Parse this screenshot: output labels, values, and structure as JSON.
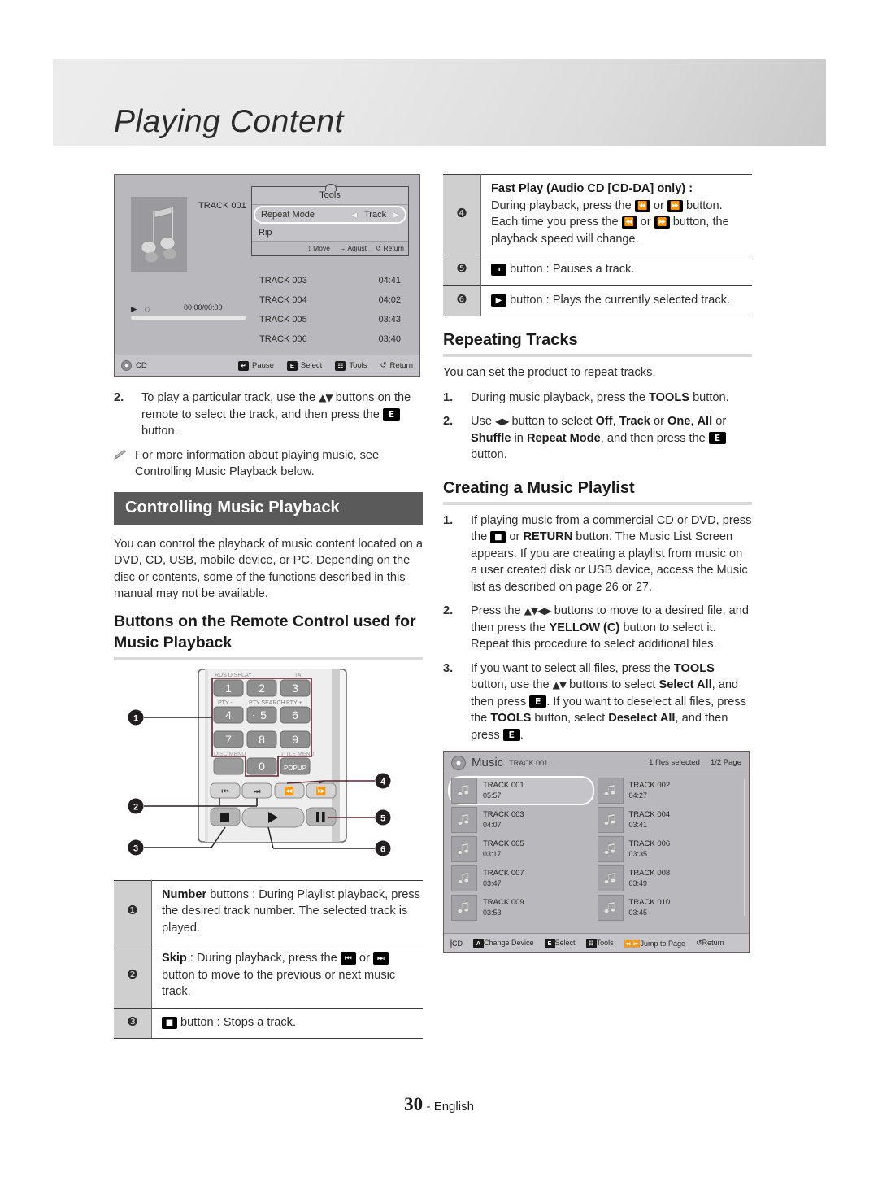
{
  "header": {
    "title": "Playing Content"
  },
  "cd_screen": {
    "now_playing_track": "TRACK 001",
    "time": "00:00/00:00",
    "tools": {
      "title": "Tools",
      "rows": [
        {
          "label": "Repeat Mode",
          "value": "Track"
        },
        {
          "label": "Rip",
          "value": ""
        }
      ],
      "footer": [
        "Move",
        "Adjust",
        "Return"
      ]
    },
    "tracks": [
      {
        "name": "TRACK 003",
        "time": "04:41"
      },
      {
        "name": "TRACK 004",
        "time": "04:02"
      },
      {
        "name": "TRACK 005",
        "time": "03:43"
      },
      {
        "name": "TRACK 006",
        "time": "03:40"
      }
    ],
    "footer": {
      "source": "CD",
      "actions": [
        "Pause",
        "Select",
        "Tools",
        "Return"
      ]
    }
  },
  "left": {
    "step2": {
      "num": "2.",
      "text_a": "To play a particular track, use the ",
      "glyph_a": "▲▼",
      "text_b": " buttons on the remote to select the track, and then press the ",
      "text_c": " button."
    },
    "note": "For more information about playing music, see Controlling Music Playback below.",
    "section_title": "Controlling Music Playback",
    "intro": "You can control the playback of music content located on a DVD, CD, USB, mobile device, or PC. Depending on the disc or contents, some of the functions described in this manual may not be available.",
    "remote_heading": "Buttons on the Remote Control used for Music Playback",
    "remote": {
      "top_labels": [
        "RDS DISPLAY",
        "TA"
      ],
      "mid_labels": [
        "PTY -",
        "PTY SEARCH",
        "PTY +"
      ],
      "bot_labels": [
        "DISC MENU",
        "TITLE MENU"
      ],
      "keys": [
        "1",
        "2",
        "3",
        "4",
        "5",
        "6",
        "7",
        "8",
        "9",
        "0"
      ],
      "popup_label": "POPUP",
      "callouts": [
        "1",
        "2",
        "3",
        "4",
        "5",
        "6"
      ]
    },
    "table": [
      {
        "num": "❶",
        "bold": "Number",
        "text": " buttons : During Playlist playback, press the desired track number. The selected track is played."
      },
      {
        "num": "❷",
        "bold": "Skip",
        "text_a": " : During playback, press the ",
        "text_b": " or ",
        "text_c": " button to move to the previous or next music track."
      },
      {
        "num": "❸",
        "text": " button : Stops a track."
      }
    ]
  },
  "right": {
    "table": [
      {
        "num": "❹",
        "bold": "Fast Play (Audio CD [CD-DA] only) :",
        "line1_a": "During playback, press the ",
        "line1_b": " or ",
        "line1_c": " button.",
        "line2_a": "Each time you press the ",
        "line2_b": " or ",
        "line2_c": " button, the playback speed will change."
      },
      {
        "num": "❺",
        "text": " button : Pauses a track."
      },
      {
        "num": "❻",
        "text": " button : Plays the currently selected track."
      }
    ],
    "repeating": {
      "heading": "Repeating Tracks",
      "intro": "You can set the product to repeat tracks.",
      "steps": [
        {
          "num": "1.",
          "text_a": "During music playback, press the ",
          "bold": "TOOLS",
          "text_b": " button."
        },
        {
          "num": "2.",
          "text_a": "Use ",
          "glyph": "◀▶",
          "text_b": " button to select ",
          "opt1": "Off",
          "sep1": ", ",
          "opt2": "Track",
          "sep2": " or ",
          "opt3": "One",
          "sep3": ", ",
          "opt4": "All",
          "sep4": " or ",
          "opt5": "Shuffle",
          "text_c": " in ",
          "opt6": "Repeat Mode",
          "text_d": ", and then press the ",
          "text_e": " button."
        }
      ]
    },
    "playlist": {
      "heading": "Creating a Music Playlist",
      "steps": [
        {
          "num": "1.",
          "text_a": "If playing music from a commercial CD or DVD, press the ",
          "text_b": " or ",
          "bold1": "RETURN",
          "text_c": " button. The Music List Screen appears. If you are creating a playlist from music on a user created disk or USB device, access the Music list as described on page 26 or 27."
        },
        {
          "num": "2.",
          "text_a": "Press the ",
          "glyph": "▲▼◀▶",
          "text_b": " buttons to move to a desired file, and then press the ",
          "bold1": "YELLOW (C)",
          "text_c": " button to select it. Repeat this procedure to select additional files."
        },
        {
          "num": "3.",
          "text_a": "If you want to select all files, press the ",
          "bold1": "TOOLS",
          "text_b": " button, use the ",
          "glyph": "▲▼",
          "text_c": " buttons to select ",
          "bold2": "Select All",
          "text_d": ", and then press ",
          "text_e": ". If you want to deselect all files, press the ",
          "bold3": "TOOLS",
          "text_f": " button, select ",
          "bold4": "Deselect All",
          "text_g": ", and then press ",
          "text_h": "."
        }
      ]
    }
  },
  "music_screen": {
    "title": "Music",
    "subtitle": "TRACK 001",
    "selected_count": "1 files selected",
    "page": "1/2 Page",
    "items": [
      {
        "name": "TRACK 001",
        "time": "05:57",
        "selected": true
      },
      {
        "name": "TRACK 002",
        "time": "04:27",
        "selected": false
      },
      {
        "name": "TRACK 003",
        "time": "04:07",
        "selected": false
      },
      {
        "name": "TRACK 004",
        "time": "03:41",
        "selected": false
      },
      {
        "name": "TRACK 005",
        "time": "03:17",
        "selected": false
      },
      {
        "name": "TRACK 006",
        "time": "03:35",
        "selected": false
      },
      {
        "name": "TRACK 007",
        "time": "03:47",
        "selected": false
      },
      {
        "name": "TRACK 008",
        "time": "03:49",
        "selected": false
      },
      {
        "name": "TRACK 009",
        "time": "03:53",
        "selected": false
      },
      {
        "name": "TRACK 010",
        "time": "03:45",
        "selected": false
      }
    ],
    "footer": {
      "source": "CD",
      "actions": [
        "Change Device",
        "Select",
        "Tools",
        "Jump to Page",
        "Return"
      ]
    }
  },
  "footer": {
    "page_number": "30",
    "language": "- English"
  },
  "colors": {
    "bar": "#5a5a5a",
    "rule": "#d9d9d9",
    "text": "#2d2d2d"
  }
}
